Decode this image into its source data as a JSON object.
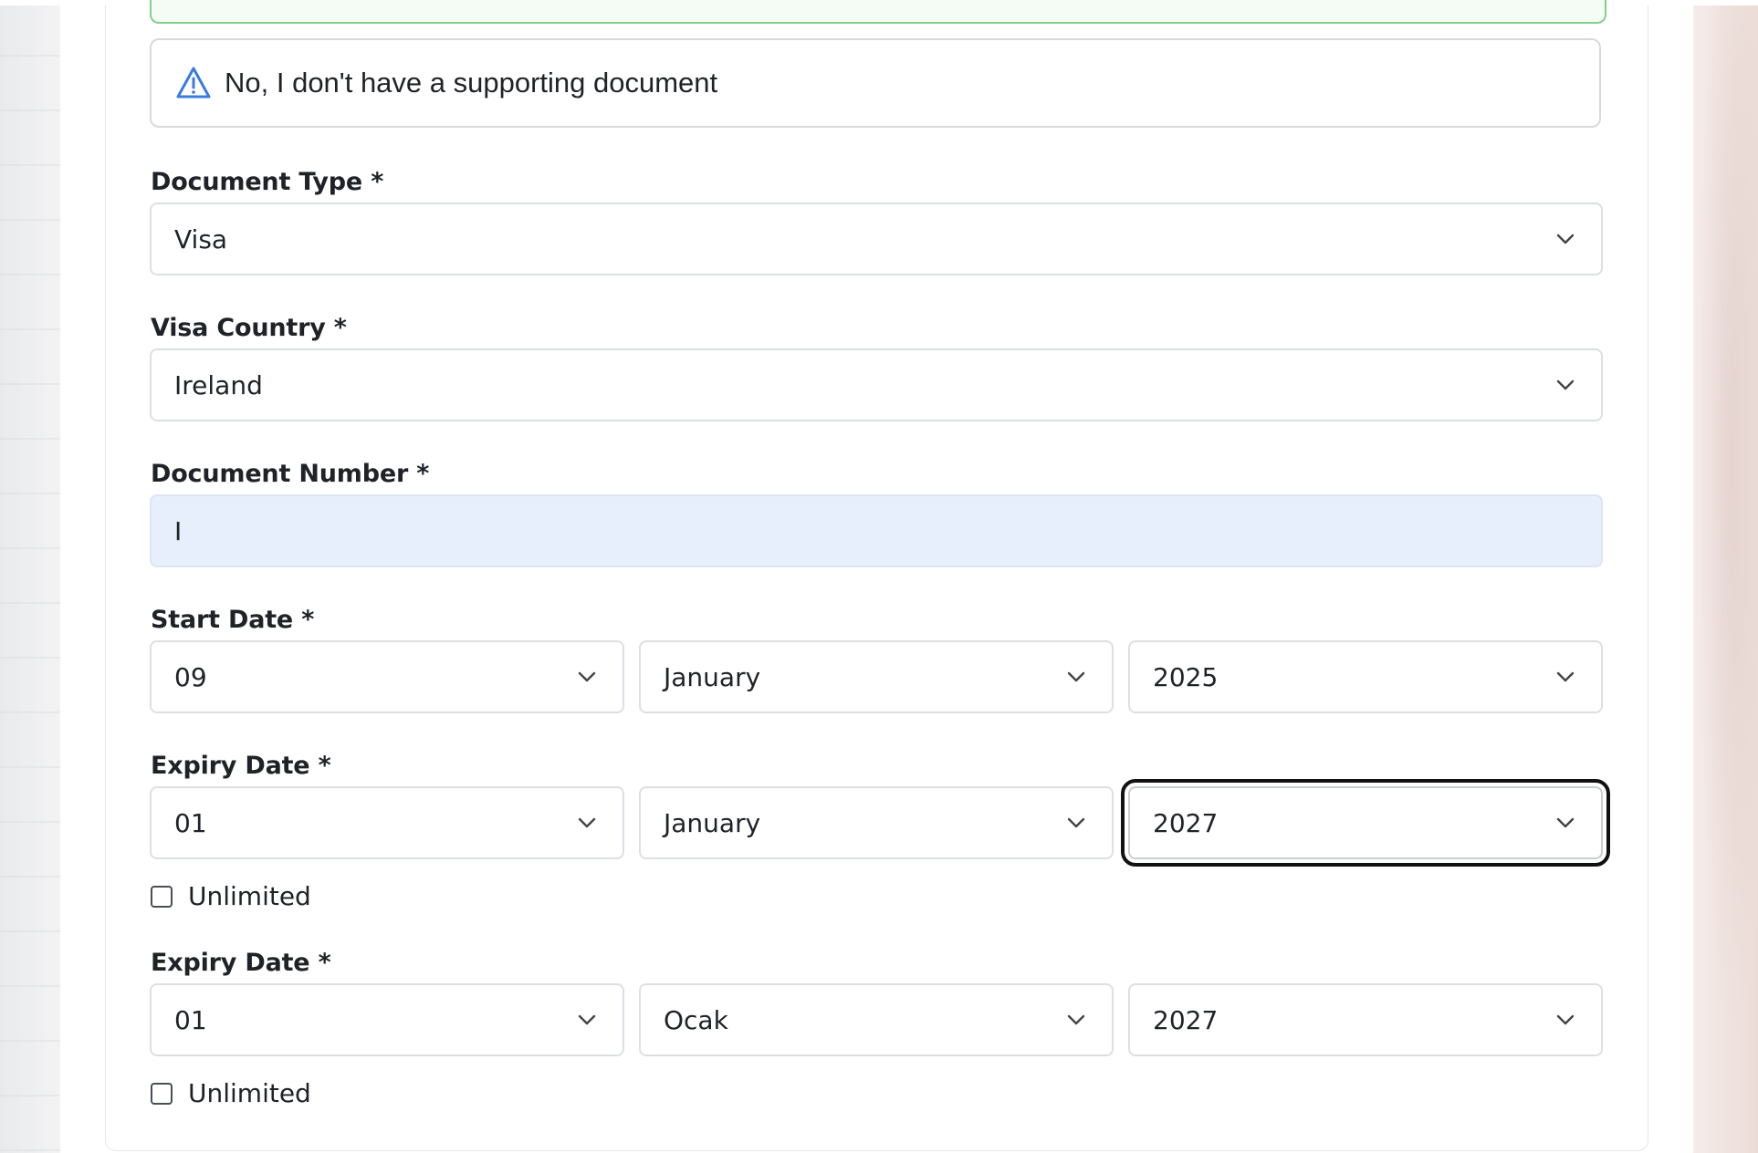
{
  "alert": {
    "text": "No, I don't have a supporting document",
    "icon": "warning-triangle-icon",
    "icon_color": "#3b7be0"
  },
  "document_type": {
    "label": "Document Type *",
    "value": "Visa"
  },
  "visa_country": {
    "label": "Visa Country *",
    "value": "Ireland"
  },
  "document_number": {
    "label": "Document Number *",
    "value": "I"
  },
  "start_date": {
    "label": "Start Date *",
    "day": "09",
    "month": "January",
    "year": "2025"
  },
  "expiry_date_1": {
    "label": "Expiry Date *",
    "day": "01",
    "month": "January",
    "year": "2027",
    "unlimited_label": "Unlimited"
  },
  "expiry_date_2": {
    "label": "Expiry Date *",
    "day": "01",
    "month": "Ocak",
    "year": "2027",
    "unlimited_label": "Unlimited"
  },
  "colors": {
    "text_field_bg": "#e8effc",
    "success_border": "#7fd08d",
    "focus_ring": "#111111"
  }
}
